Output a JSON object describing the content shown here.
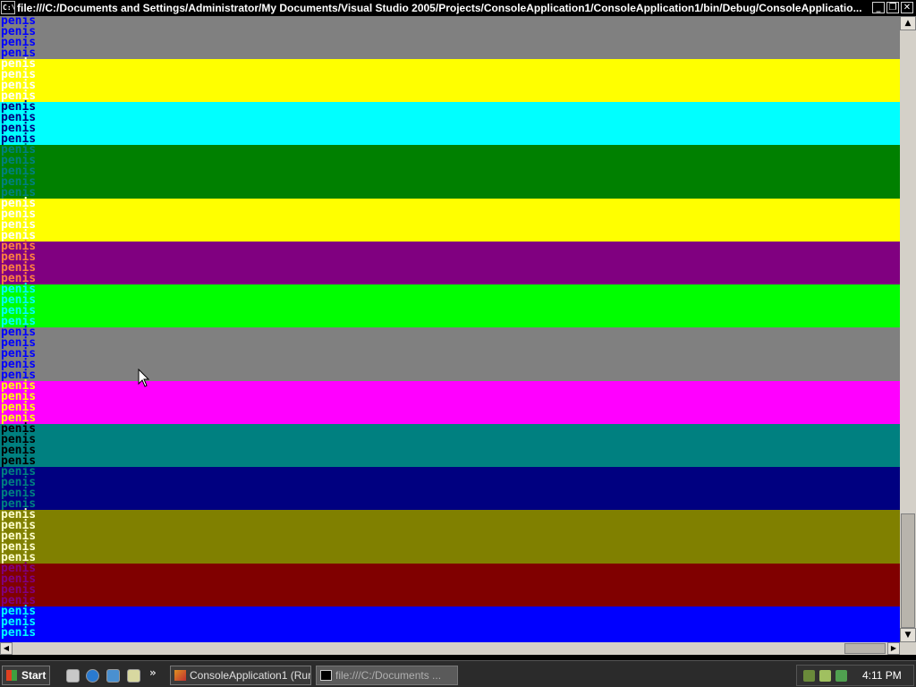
{
  "window": {
    "title": "file:///C:/Documents and Settings/Administrator/My Documents/Visual Studio 2005/Projects/ConsoleApplication1/ConsoleApplication1/bin/Debug/ConsoleApplicatio...",
    "icon_text": "C:\\",
    "icon": "console-window-icon",
    "minimize": "_",
    "maximize": "❐",
    "close": "✕"
  },
  "console": {
    "line_text": "penis",
    "bands": [
      {
        "bg": "#808080",
        "fg": "#0000ff",
        "line_bg": "#808080",
        "lines": 4
      },
      {
        "bg": "#ffff00",
        "fg": "#ffffff",
        "line_bg": "#ffff00",
        "lines": 4
      },
      {
        "bg": "#00ffff",
        "fg": "#000080",
        "line_bg": "#00ffff",
        "lines": 4
      },
      {
        "bg": "#008000",
        "fg": "#008080",
        "line_bg": "#008000",
        "lines": 5
      },
      {
        "bg": "#ffff00",
        "fg": "#ffffff",
        "line_bg": "#ffff00",
        "lines": 4
      },
      {
        "bg": "#800080",
        "fg": "#ff8040",
        "line_bg": "#800080",
        "lines": 4
      },
      {
        "bg": "#00ff00",
        "fg": "#00ffff",
        "line_bg": "#00ff00",
        "lines": 4
      },
      {
        "bg": "#808080",
        "fg": "#0000ff",
        "line_bg": "#808080",
        "lines": 5
      },
      {
        "bg": "#ff00ff",
        "fg": "#ffff00",
        "line_bg": "#ff00ff",
        "lines": 4
      },
      {
        "bg": "#008080",
        "fg": "#000000",
        "line_bg": "#008080",
        "lines": 4
      },
      {
        "bg": "#000080",
        "fg": "#008080",
        "line_bg": "#000080",
        "lines": 4
      },
      {
        "bg": "#808000",
        "fg": "#ffffcc",
        "line_bg": "#808000",
        "lines": 5
      },
      {
        "bg": "#800000",
        "fg": "#800080",
        "line_bg": "#800000",
        "lines": 4
      },
      {
        "bg": "#0000ff",
        "fg": "#00ffff",
        "line_bg": "#0000ff",
        "lines": 3
      }
    ]
  },
  "scrollbars": {
    "up_arrow": "▲",
    "down_arrow": "▼",
    "left_arrow": "◀",
    "right_arrow": "▶"
  },
  "taskbar": {
    "start_label": "Start",
    "chevron": "»",
    "tasks": [
      {
        "label": "ConsoleApplication1 (Run...",
        "icon": "visual-studio-icon"
      },
      {
        "label": "file:///C:/Documents ...",
        "icon": "console-window-icon"
      }
    ],
    "clock": "4:11 PM"
  },
  "colors": {
    "title_bg": "#000000",
    "taskbar_bg": "#2b2b2b"
  }
}
